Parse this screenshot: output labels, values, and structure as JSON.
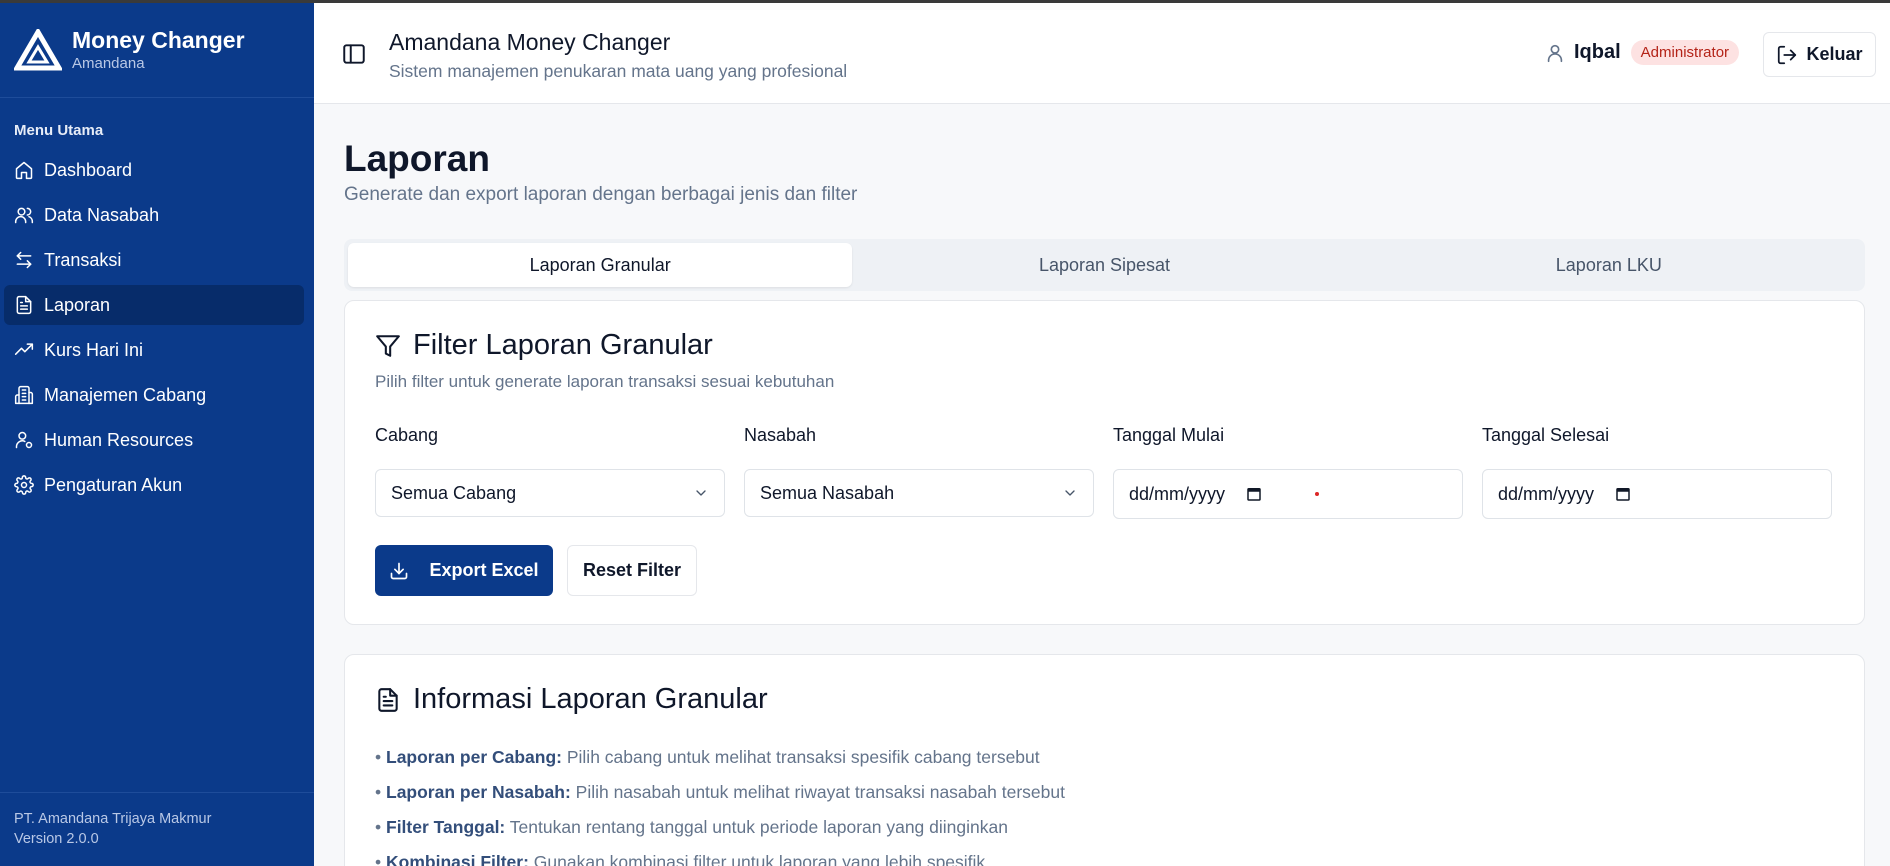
{
  "sidebar": {
    "brand_title": "Money Changer",
    "brand_sub": "Amandana",
    "menu_heading": "Menu Utama",
    "items": [
      {
        "label": "Dashboard",
        "icon": "home-icon"
      },
      {
        "label": "Data Nasabah",
        "icon": "users-icon"
      },
      {
        "label": "Transaksi",
        "icon": "arrows-exchange-icon"
      },
      {
        "label": "Laporan",
        "icon": "file-text-icon",
        "active": true
      },
      {
        "label": "Kurs Hari Ini",
        "icon": "trending-up-icon"
      },
      {
        "label": "Manajemen Cabang",
        "icon": "building-icon"
      },
      {
        "label": "Human Resources",
        "icon": "user-cog-icon"
      },
      {
        "label": "Pengaturan Akun",
        "icon": "gear-icon"
      }
    ],
    "footer_company": "PT. Amandana Trijaya Makmur",
    "footer_version": "Version 2.0.0"
  },
  "header": {
    "title": "Amandana Money Changer",
    "subtitle": "Sistem manajemen penukaran mata uang yang profesional",
    "user_name": "Iqbal",
    "role": "Administrator",
    "logout_label": "Keluar"
  },
  "page": {
    "title": "Laporan",
    "subtitle": "Generate dan export laporan dengan berbagai jenis dan filter"
  },
  "tabs": [
    {
      "label": "Laporan Granular",
      "active": true
    },
    {
      "label": "Laporan Sipesat"
    },
    {
      "label": "Laporan LKU"
    }
  ],
  "filter": {
    "title": "Filter Laporan Granular",
    "subtitle": "Pilih filter untuk generate laporan transaksi sesuai kebutuhan",
    "cabang_label": "Cabang",
    "cabang_value": "Semua Cabang",
    "nasabah_label": "Nasabah",
    "nasabah_value": "Semua Nasabah",
    "start_label": "Tanggal Mulai",
    "start_value": "dd/mm/yyyy",
    "end_label": "Tanggal Selesai",
    "end_value": "dd/mm/yyyy",
    "export_label": "Export Excel",
    "reset_label": "Reset Filter"
  },
  "info": {
    "title": "Informasi Laporan Granular",
    "items": [
      {
        "key": "Laporan per Cabang:",
        "text": " Pilih cabang untuk melihat transaksi spesifik cabang tersebut"
      },
      {
        "key": "Laporan per Nasabah:",
        "text": " Pilih nasabah untuk melihat riwayat transaksi nasabah tersebut"
      },
      {
        "key": "Filter Tanggal:",
        "text": " Tentukan rentang tanggal untuk periode laporan yang diinginkan"
      },
      {
        "key": "Kombinasi Filter:",
        "text": " Gunakan kombinasi filter untuk laporan yang lebih spesifik"
      }
    ]
  },
  "colors": {
    "sidebar_bg": "#0b3a8a",
    "sidebar_active": "#072c6a",
    "primary_button": "#0b3a8a",
    "role_badge_bg": "#fde2e2",
    "role_badge_text": "#b42318"
  }
}
